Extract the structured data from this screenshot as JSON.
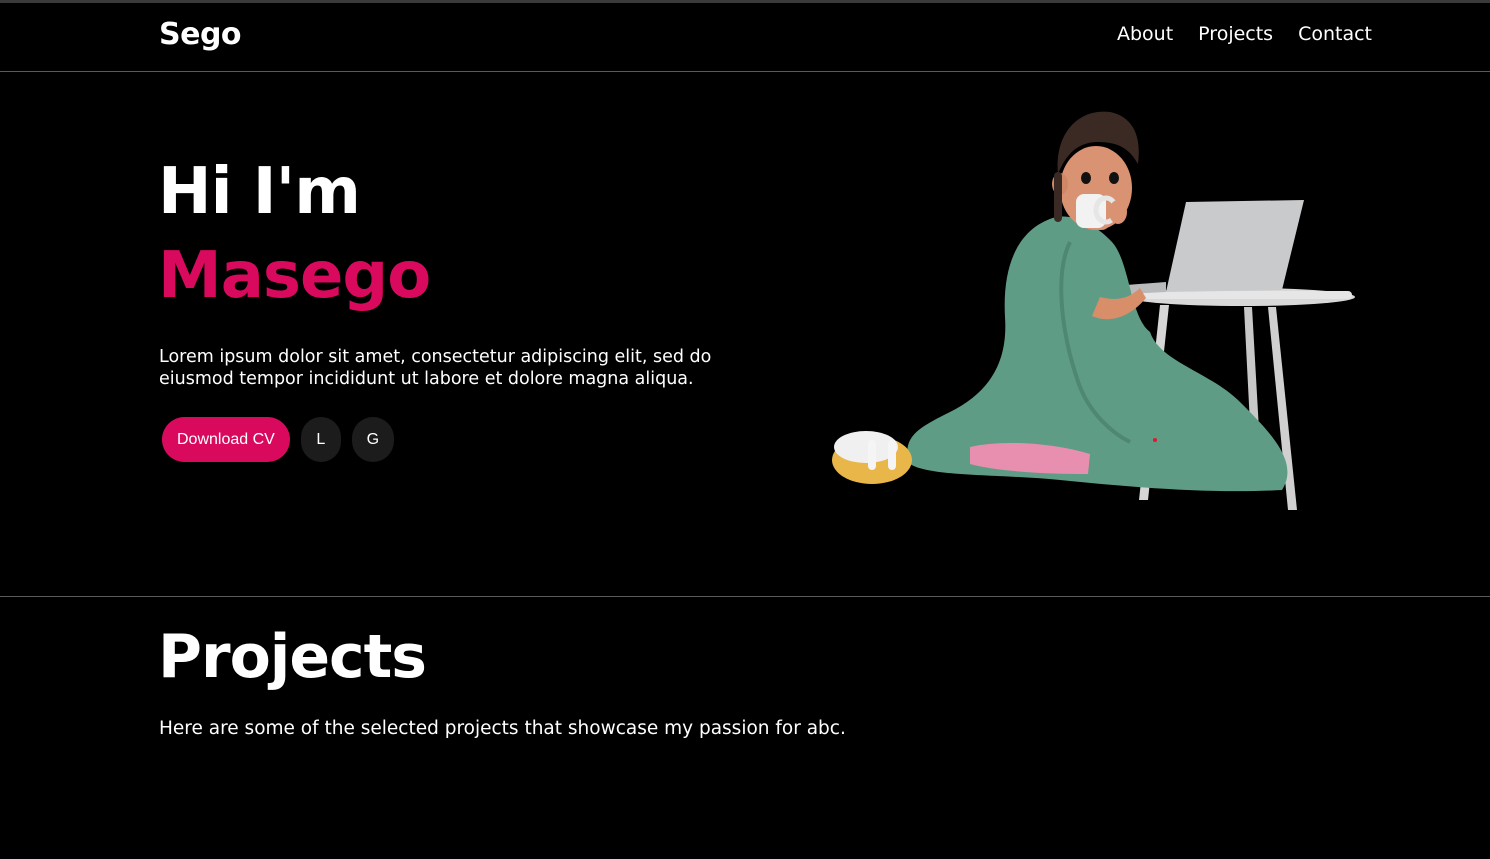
{
  "colors": {
    "background": "#000000",
    "accent": "#d90a5e",
    "text": "#ffffff",
    "social_button_bg": "#1c1c1c",
    "divider": "#5a5a5a"
  },
  "navbar": {
    "logo": "Sego",
    "links": [
      {
        "label": "About"
      },
      {
        "label": "Projects"
      },
      {
        "label": "Contact"
      }
    ]
  },
  "hero": {
    "greeting": "Hi I'm",
    "name": "Masego",
    "description": "Lorem ipsum dolor sit amet, consectetur adipiscing elit, sed do eiusmod tempor incididunt ut labore et dolore magna aliqua.",
    "download_cv_label": "Download CV",
    "social_buttons": [
      {
        "label": "L"
      },
      {
        "label": "G"
      }
    ],
    "illustration_icon": "person-with-laptop-illustration"
  },
  "projects": {
    "title": "Projects",
    "subtitle": "Here are some of the selected projects that showcase my passion for abc."
  }
}
